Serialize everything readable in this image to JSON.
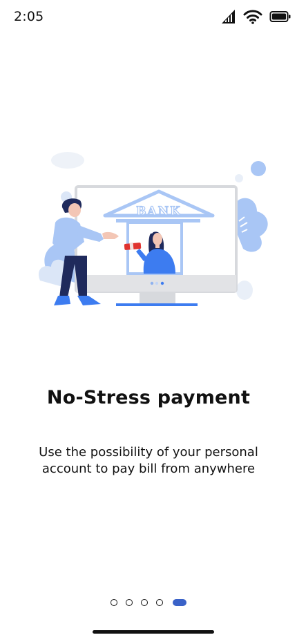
{
  "status_bar": {
    "time": "2:05",
    "icons": [
      "cellular-signal-icon",
      "wifi-icon",
      "battery-icon"
    ]
  },
  "illustration": {
    "name": "bank-counter-illustration",
    "sign_text": "BANK",
    "colors": {
      "accent": "#3d7cf0",
      "light_blue": "#a9c6f5",
      "navy": "#1f2a5c",
      "money_red": "#e0332f",
      "monitor_gray": "#e3e3e3"
    }
  },
  "onboarding": {
    "title": "No-Stress payment",
    "description": "Use the possibility of your personal account to pay bill from anywhere"
  },
  "pager": {
    "page_count": 5,
    "active_index": 4,
    "active_color": "#3a62c8"
  }
}
